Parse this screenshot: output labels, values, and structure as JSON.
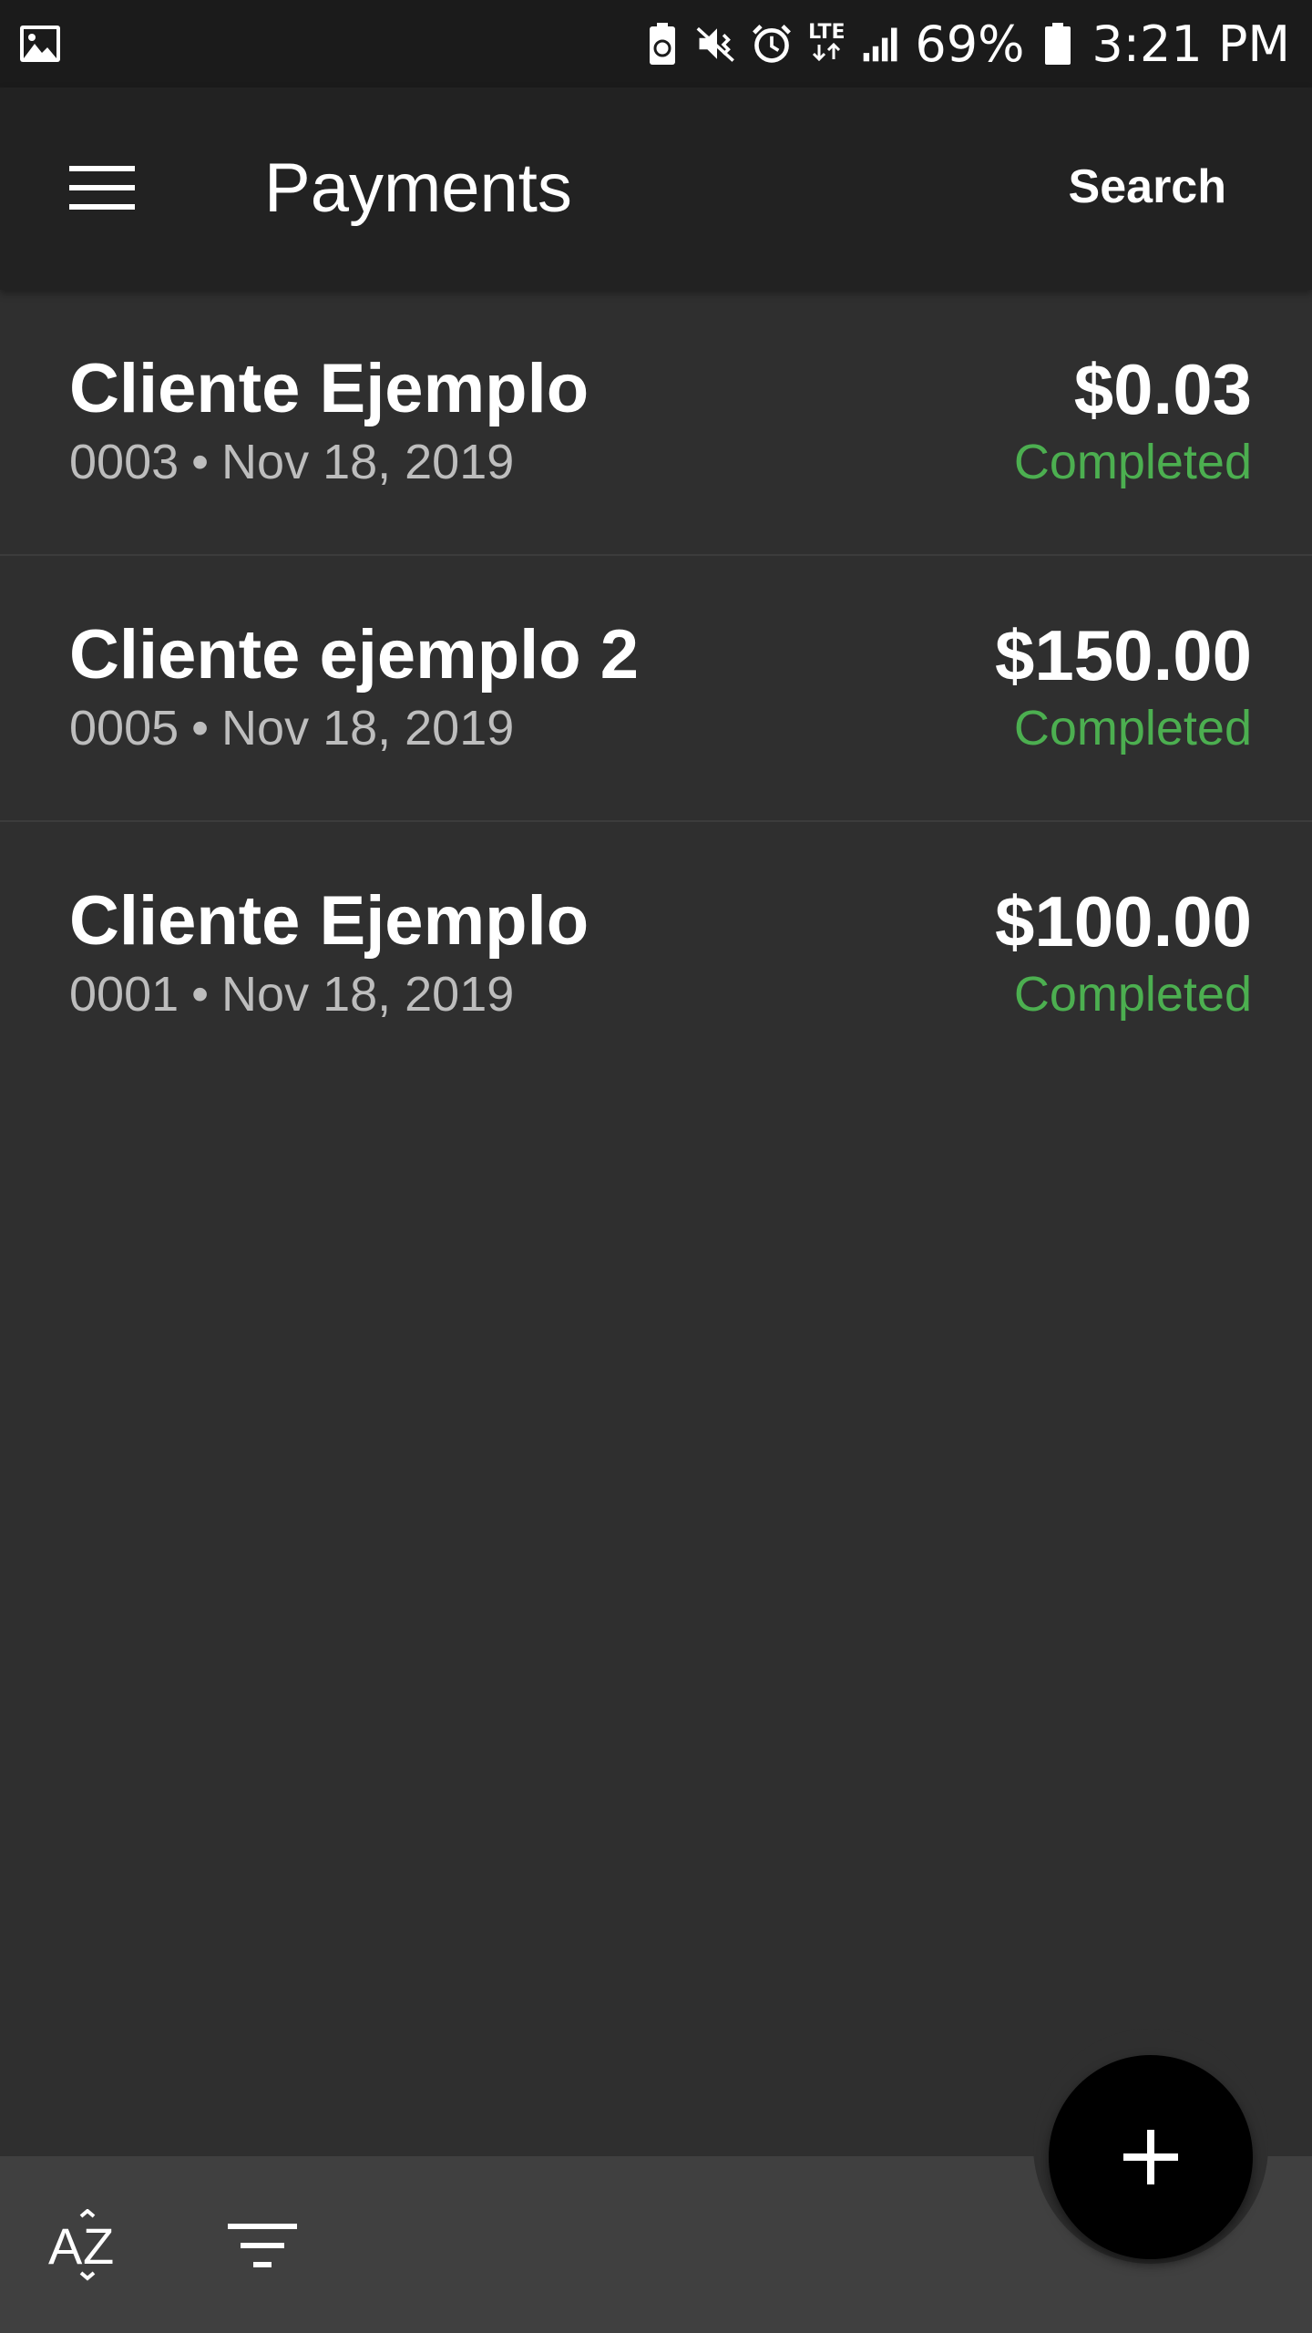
{
  "status_bar": {
    "battery_percent": "69%",
    "time": "3:21 PM",
    "network": "LTE",
    "icons": [
      "gallery-icon",
      "battery-saver-icon",
      "mute-icon",
      "alarm-icon",
      "lte-icon",
      "signal-icon",
      "battery-icon"
    ]
  },
  "app_bar": {
    "title": "Payments",
    "search_label": "Search",
    "menu_icon": "hamburger-menu-icon"
  },
  "payments": [
    {
      "client": "Cliente Ejemplo",
      "number": "0003",
      "separator": "•",
      "date": "Nov 18, 2019",
      "amount": "$0.03",
      "status": "Completed"
    },
    {
      "client": "Cliente ejemplo 2",
      "number": "0005",
      "separator": "•",
      "date": "Nov 18, 2019",
      "amount": "$150.00",
      "status": "Completed"
    },
    {
      "client": "Cliente Ejemplo",
      "number": "0001",
      "separator": "•",
      "date": "Nov 18, 2019",
      "amount": "$100.00",
      "status": "Completed"
    }
  ],
  "bottom_bar": {
    "sort_icon": "sort-az-icon",
    "filter_icon": "filter-icon",
    "fab_icon": "plus-icon"
  },
  "colors": {
    "background": "#2f2f2f",
    "app_bar": "#222222",
    "status_bar": "#1b1b1b",
    "bottom_bar": "#404040",
    "status_completed": "#4caf50",
    "text_primary": "#ffffff",
    "text_secondary": "#bdbdbd",
    "fab": "#000000"
  }
}
